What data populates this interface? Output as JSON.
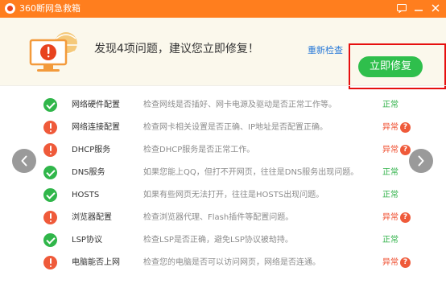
{
  "window": {
    "title": "360断网急救箱",
    "titlebar_color": "#ff7e1e",
    "icons": [
      "360-logo-icon",
      "feedback-icon",
      "minimize-icon",
      "close-icon"
    ]
  },
  "header": {
    "message": "发现4项问题，建议您立即修复！",
    "recheck_label": "重新检查",
    "fix_label": "立即修复",
    "illustration": "warning-computer-icon"
  },
  "status_labels": {
    "ok": "正常",
    "error": "异常",
    "help": "?"
  },
  "colors": {
    "ok": "#30b64a",
    "error": "#ef5a3a",
    "link": "#2a7ad8",
    "highlight_border": "#e60f0f"
  },
  "checks": [
    {
      "name": "网络硬件配置",
      "desc": "检查网线是否插好、网卡电源及驱动是否正常工作等。",
      "status": "正常",
      "ok": true
    },
    {
      "name": "网络连接配置",
      "desc": "检查网卡相关设置是否正确、IP地址是否配置正确。",
      "status": "异常",
      "ok": false
    },
    {
      "name": "DHCP服务",
      "desc": "检查DHCP服务是否正常工作。",
      "status": "异常",
      "ok": false
    },
    {
      "name": "DNS服务",
      "desc": "如果您能上QQ，但打不开网页，往往是DNS服务出现问题。",
      "status": "正常",
      "ok": true
    },
    {
      "name": "HOSTS",
      "desc": "如果有些网页无法打开，往往是HOSTS出现问题。",
      "status": "正常",
      "ok": true
    },
    {
      "name": "浏览器配置",
      "desc": "检查浏览器代理、Flash插件等配置问题。",
      "status": "异常",
      "ok": false
    },
    {
      "name": "LSP协议",
      "desc": "检查LSP是否正确，避免LSP协议被劫持。",
      "status": "正常",
      "ok": true
    },
    {
      "name": "电脑能否上网",
      "desc": "检查您的电脑是否可以访问网页，网络是否连通。",
      "status": "异常",
      "ok": false
    }
  ]
}
